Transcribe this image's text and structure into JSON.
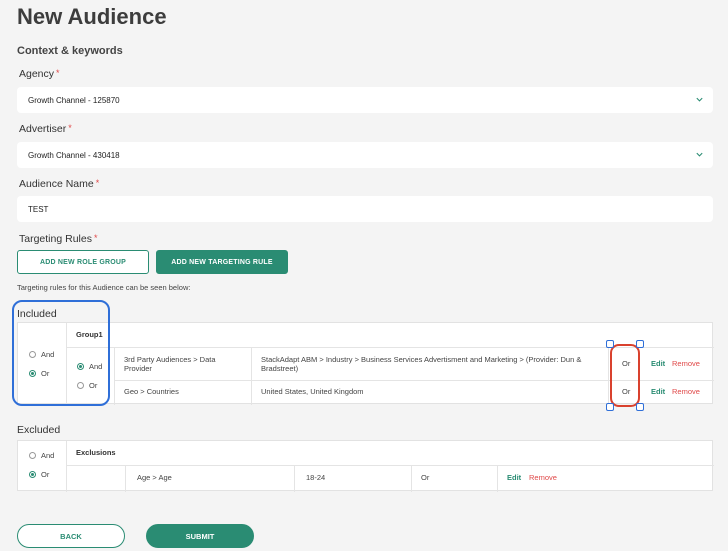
{
  "page": {
    "title": "New Audience",
    "section": "Context & keywords"
  },
  "agency": {
    "label": "Agency",
    "required": "*",
    "value": "Growth Channel - 125870"
  },
  "advertiser": {
    "label": "Advertiser",
    "required": "*",
    "value": "Growth Channel - 430418"
  },
  "audience_name": {
    "label": "Audience Name",
    "required": "*",
    "value": "TEST"
  },
  "targeting": {
    "label": "Targeting Rules",
    "required": "*",
    "add_group": "ADD NEW ROLE GROUP",
    "add_rule": "ADD NEW TARGETING RULE",
    "note": "Targeting rules for this Audience can be seen below:"
  },
  "included": {
    "label": "Included",
    "outer_and": "And",
    "outer_or": "Or",
    "outer_selected": "Or",
    "group_name": "Group1",
    "group_and": "And",
    "group_or": "Or",
    "group_selected": "And",
    "rows": [
      {
        "category": "3rd Party Audiences > Data Provider",
        "value": "StackAdapt ABM > Industry > Business Services Advertisment and Marketing > (Provider: Dun & Bradstreet)",
        "op": "Or",
        "edit": "Edit",
        "remove": "Remove"
      },
      {
        "category": "Geo > Countries",
        "value": "United States, United Kingdom",
        "op": "Or",
        "edit": "Edit",
        "remove": "Remove"
      }
    ]
  },
  "excluded": {
    "label": "Excluded",
    "outer_and": "And",
    "outer_or": "Or",
    "outer_selected": "Or",
    "group_name": "Exclusions",
    "rows": [
      {
        "category": "Age > Age",
        "value": "18-24",
        "op": "Or",
        "edit": "Edit",
        "remove": "Remove"
      }
    ]
  },
  "footer": {
    "back": "BACK",
    "submit": "SUBMIT"
  },
  "colors": {
    "accent": "#2a8c73",
    "danger": "#e04848",
    "highlight_blue": "#2f6fd8",
    "highlight_red": "#d9412e"
  }
}
